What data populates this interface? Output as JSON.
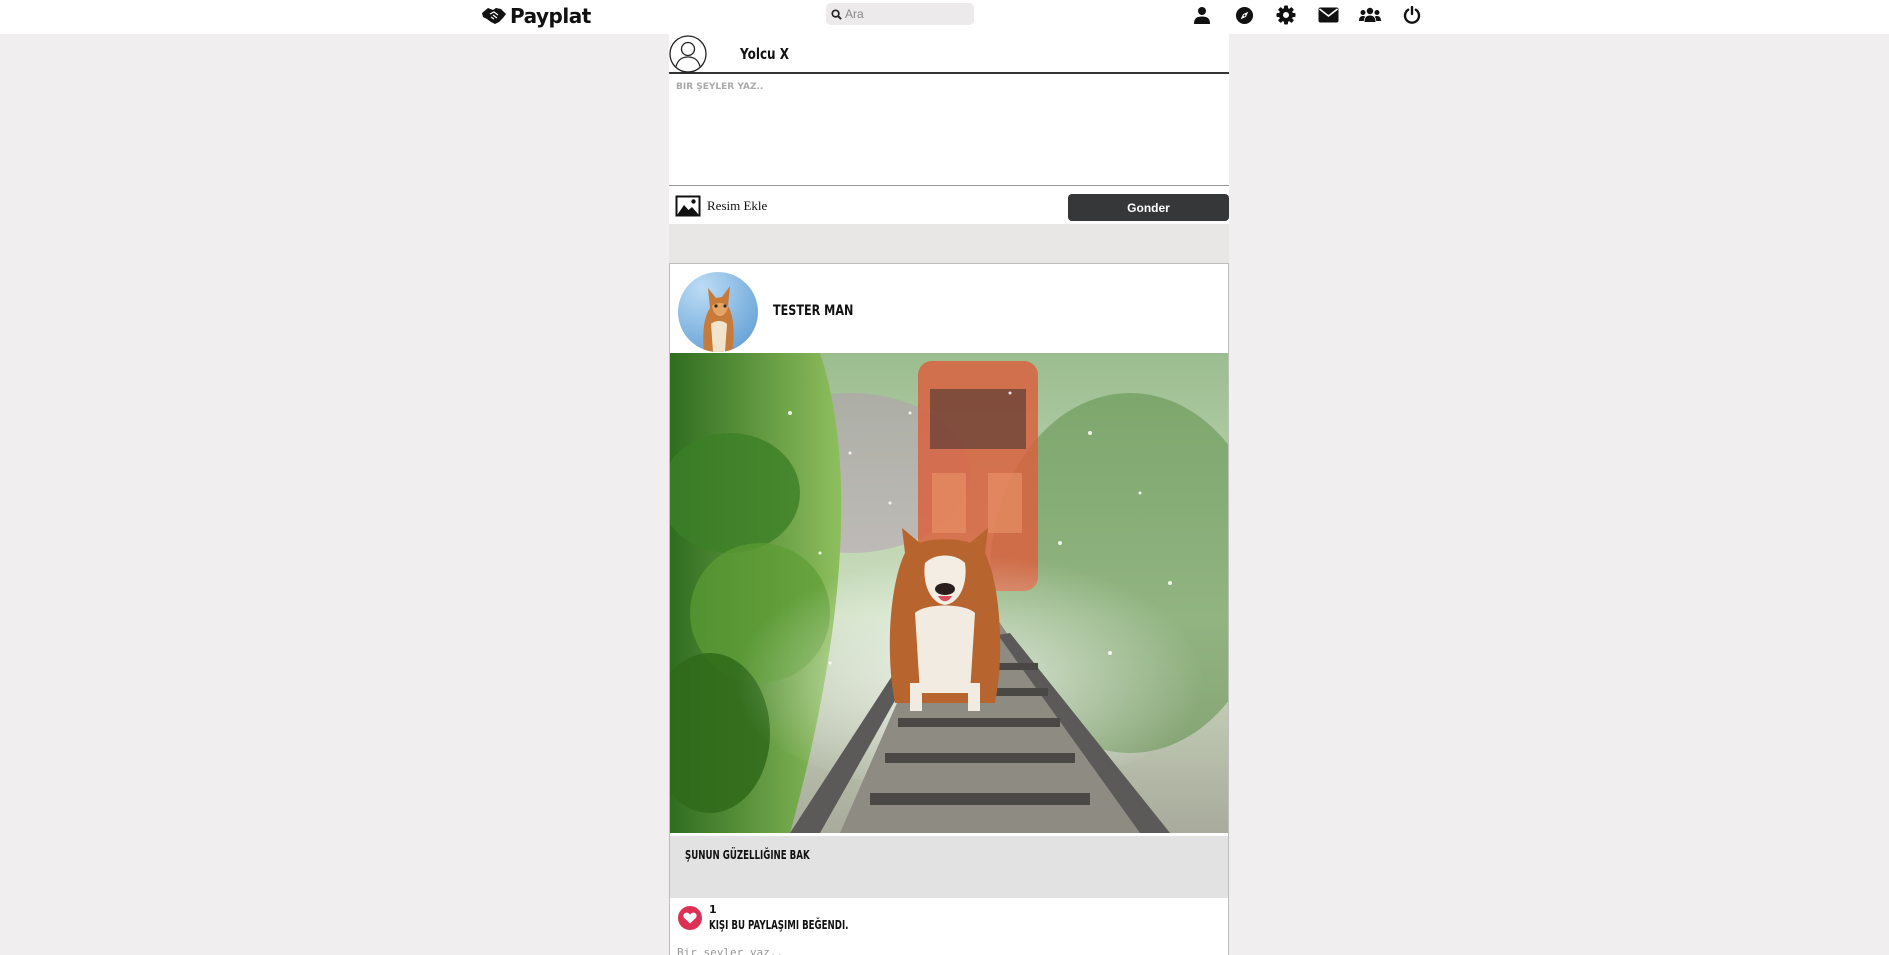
{
  "app": {
    "name": "Payplat"
  },
  "search": {
    "placeholder": "Ara"
  },
  "nav": {
    "icons": [
      "profile-icon",
      "compass-icon",
      "settings-icon",
      "mail-icon",
      "friends-icon",
      "power-icon"
    ]
  },
  "composer": {
    "user_name": "Yolcu X",
    "placeholder": "Bir şeyler yaz..",
    "add_image_label": "Resim Ekle",
    "send_label": "Gonder"
  },
  "post": {
    "author": "TESTER MAN",
    "caption": "ŞUNUN GÜZELLIĞINE BAK",
    "like_count": "1",
    "like_text": "KIŞI BU PAYLAŞIMI BEĞENDI.",
    "comment_placeholder": "Bir şeyler yaz.."
  },
  "colors": {
    "background": "#f0eeef",
    "button_dark": "#363738",
    "like_red": "#de2f55"
  }
}
